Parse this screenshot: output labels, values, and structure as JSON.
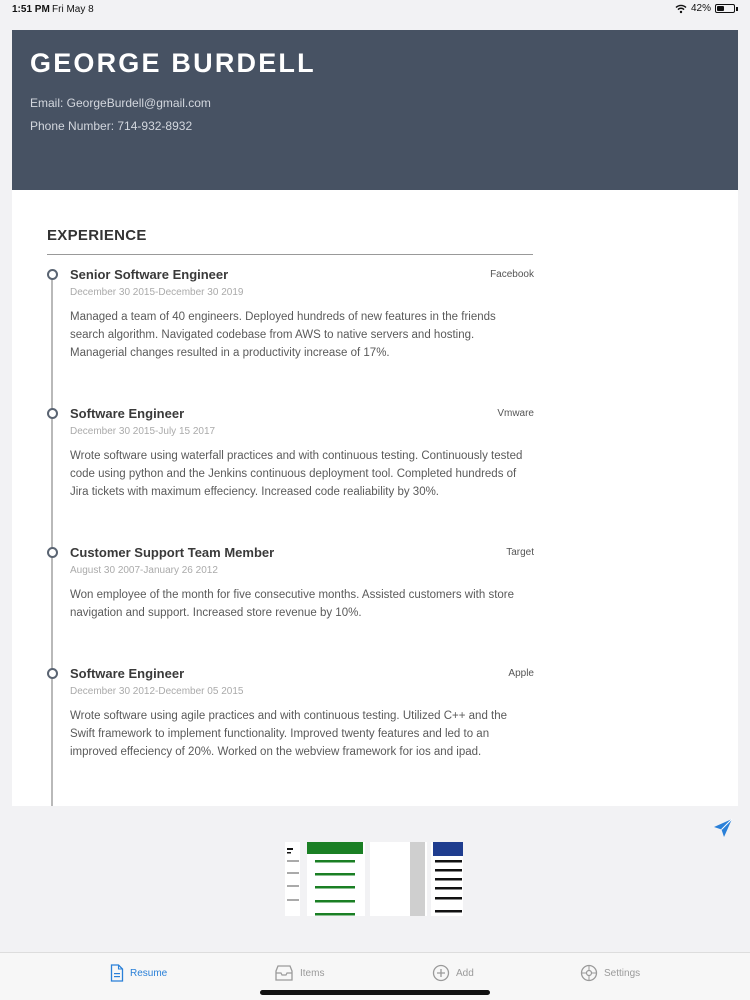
{
  "status": {
    "time": "1:51 PM",
    "date": "Fri May 8",
    "battery": "42%",
    "battery_level": 0.42
  },
  "resume": {
    "name": "GEORGE BURDELL",
    "email": "Email: GeorgeBurdell@gmail.com",
    "phone": "Phone Number: 714-932-8932",
    "section_title": "EXPERIENCE",
    "jobs": [
      {
        "title": "Senior Software Engineer",
        "company": "Facebook",
        "dates": "December 30 2015-December 30 2019",
        "description": "Managed a team of 40 engineers. Deployed hundreds of new features in the friends search algorithm. Navigated codebase from AWS to native servers and hosting. Managerial changes resulted in a productivity increase of 17%."
      },
      {
        "title": "Software Engineer",
        "company": "Vmware",
        "dates": "December 30 2015-July 15 2017",
        "description": "Wrote software using waterfall practices and with continuous testing. Continuously tested code using python and the Jenkins continuous deployment tool. Completed hundreds of Jira tickets with maximum effeciency. Increased code realiability by 30%."
      },
      {
        "title": "Customer Support Team Member",
        "company": "Target",
        "dates": "August 30 2007-January 26 2012",
        "description": "Won employee of the month for five consecutive months. Assisted customers with store navigation and support. Increased store revenue by 10%."
      },
      {
        "title": "Software Engineer",
        "company": "Apple",
        "dates": "December 30 2012-December 05 2015",
        "description": "Wrote software using agile practices and with continuous testing. Utilized C++ and the Swift framework to implement functionality. Improved twenty features and led to an improved effeciency of 20%. Worked on the webview framework for ios and ipad."
      }
    ]
  },
  "icons": {
    "send": "send-icon",
    "wifi": "wifi-icon",
    "battery": "battery-icon"
  },
  "colors": {
    "header_bg": "#475263",
    "accent": "#2a80d8",
    "thumb_green": "#1a7f24",
    "thumb_blue": "#1f3d8f"
  },
  "tabs": [
    {
      "label": "Resume",
      "icon": "document-icon",
      "active": true
    },
    {
      "label": "Items",
      "icon": "tray-icon",
      "active": false
    },
    {
      "label": "Add",
      "icon": "plus-circle-icon",
      "active": false
    },
    {
      "label": "Settings",
      "icon": "gear-icon",
      "active": false
    }
  ]
}
